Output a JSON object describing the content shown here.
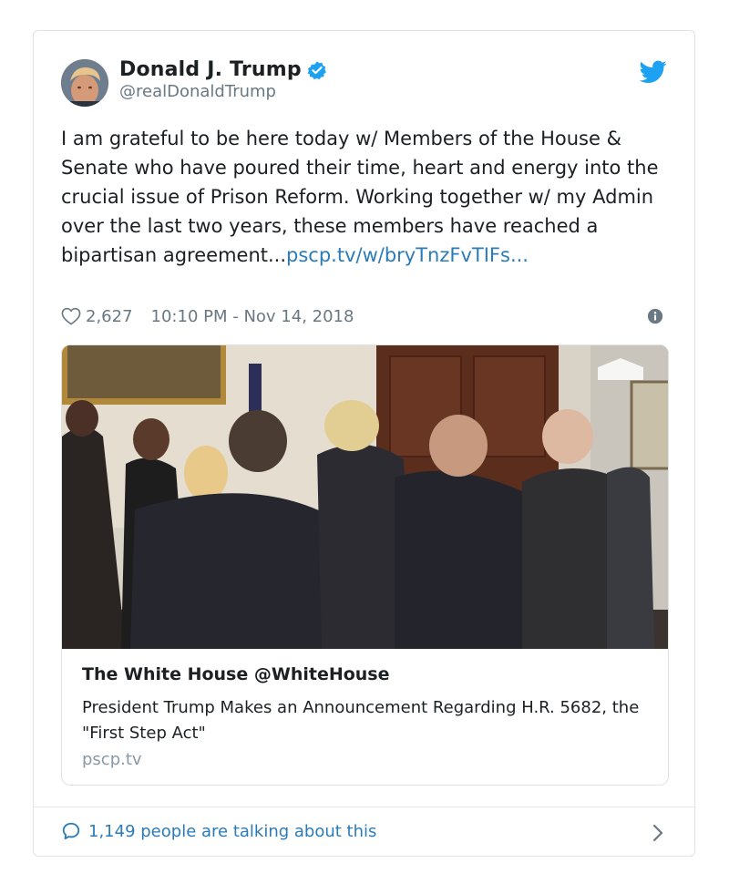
{
  "tweet": {
    "author": {
      "display_name": "Donald J. Trump",
      "handle": "@realDonaldTrump",
      "verified": true,
      "avatar_icon": "profile-photo"
    },
    "text_main": "I am grateful to be here today w/ Members of the House & Senate who have poured their time, heart and energy into the crucial issue of Prison Reform. Working together w/ my Admin over the last two years, these members have reached a bipartisan agreement...",
    "text_link": "pscp.tv/w/bryTnzFvTIFs...",
    "likes": "2,627",
    "timestamp": "10:10 PM - Nov 14, 2018"
  },
  "media_card": {
    "author_line": "The White House @WhiteHouse",
    "description": "President Trump Makes an Announcement Regarding H.R. 5682, the \"First Step Act\"",
    "domain": "pscp.tv",
    "watermark_icon": "white-house-logo"
  },
  "footer": {
    "talking": "1,149 people are talking about this"
  },
  "colors": {
    "link": "#2b7bb9",
    "twitter_blue": "#1da1f2",
    "muted": "#697882",
    "border": "#dfe3e6"
  }
}
